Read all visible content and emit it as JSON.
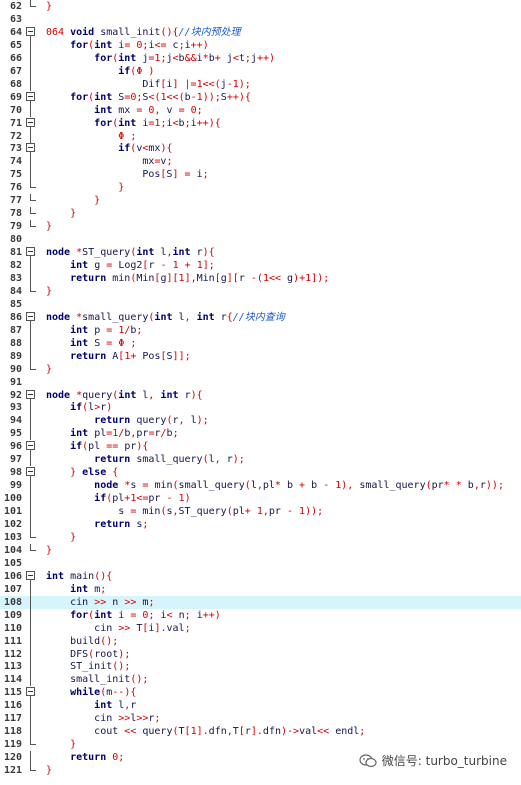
{
  "editor": {
    "highlight_line": 108,
    "lines": [
      {
        "n": "62",
        "fold": "end",
        "text": "}"
      },
      {
        "n": "63",
        "fold": "",
        "text": ""
      },
      {
        "n": "64",
        "fold": "open",
        "text": "064 void small_init(){//块内预处理"
      },
      {
        "n": "65",
        "fold": "bar",
        "text": "    for(int i= 0;i<= c;i++)"
      },
      {
        "n": "66",
        "fold": "bar",
        "text": "        for(int j=1;j<b&&i*b+ j<t;j++)"
      },
      {
        "n": "67",
        "fold": "bar",
        "text": "            if(Φ )"
      },
      {
        "n": "68",
        "fold": "bar",
        "text": "                Dif[i] |=1<<(j-1);"
      },
      {
        "n": "69",
        "fold": "open",
        "text": "    for(int S=0;S<(1<<(b-1));S++){"
      },
      {
        "n": "70",
        "fold": "bar",
        "text": "        int mx = 0, v = 0;"
      },
      {
        "n": "71",
        "fold": "open",
        "text": "        for(int i=1;i<b;i++){"
      },
      {
        "n": "72",
        "fold": "bar",
        "text": "            Φ ;"
      },
      {
        "n": "73",
        "fold": "open",
        "text": "            if(v<mx){"
      },
      {
        "n": "74",
        "fold": "bar",
        "text": "                mx=v;"
      },
      {
        "n": "75",
        "fold": "bar",
        "text": "                Pos[S] = i;"
      },
      {
        "n": "76",
        "fold": "end",
        "text": "            }"
      },
      {
        "n": "77",
        "fold": "end",
        "text": "        }"
      },
      {
        "n": "78",
        "fold": "end",
        "text": "    }"
      },
      {
        "n": "79",
        "fold": "end",
        "text": "}"
      },
      {
        "n": "80",
        "fold": "",
        "text": ""
      },
      {
        "n": "81",
        "fold": "open",
        "text": "node *ST_query(int l,int r){"
      },
      {
        "n": "82",
        "fold": "bar",
        "text": "    int g = Log2[r - 1 + 1];"
      },
      {
        "n": "83",
        "fold": "bar",
        "text": "    return min(Min[g][1],Min[g][r -(1<< g)+1]);"
      },
      {
        "n": "84",
        "fold": "end",
        "text": "}"
      },
      {
        "n": "85",
        "fold": "",
        "text": ""
      },
      {
        "n": "86",
        "fold": "open",
        "text": "node *small_query(int l, int r{//块内查询"
      },
      {
        "n": "87",
        "fold": "bar",
        "text": "    int p = 1/b;"
      },
      {
        "n": "88",
        "fold": "bar",
        "text": "    int S = Φ ;"
      },
      {
        "n": "89",
        "fold": "bar",
        "text": "    return A[1+ Pos[S]];"
      },
      {
        "n": "90",
        "fold": "end",
        "text": "}"
      },
      {
        "n": "91",
        "fold": "",
        "text": ""
      },
      {
        "n": "92",
        "fold": "open",
        "text": "node *query(int l, int r){"
      },
      {
        "n": "93",
        "fold": "bar",
        "text": "    if(l>r)"
      },
      {
        "n": "94",
        "fold": "bar",
        "text": "        return query(r, l);"
      },
      {
        "n": "95",
        "fold": "bar",
        "text": "    int pl=1/b,pr=r/b;"
      },
      {
        "n": "96",
        "fold": "open",
        "text": "    if(pl == pr){"
      },
      {
        "n": "97",
        "fold": "bar",
        "text": "        return small_query(l, r);"
      },
      {
        "n": "98",
        "fold": "open",
        "text": "    } else {"
      },
      {
        "n": "99",
        "fold": "bar",
        "text": "        node *s = min(small_query(l,pl* b + b - 1), small_query(pr* * b,r));"
      },
      {
        "n": "100",
        "fold": "bar",
        "text": "        if(pl+1<=pr - 1)"
      },
      {
        "n": "101",
        "fold": "bar",
        "text": "            s = min(s,ST_query(pl+ 1,pr - 1));"
      },
      {
        "n": "102",
        "fold": "bar",
        "text": "        return s;"
      },
      {
        "n": "103",
        "fold": "end",
        "text": "    }"
      },
      {
        "n": "104",
        "fold": "end",
        "text": "}"
      },
      {
        "n": "105",
        "fold": "",
        "text": ""
      },
      {
        "n": "106",
        "fold": "open",
        "text": "int main(){"
      },
      {
        "n": "107",
        "fold": "bar",
        "text": "    int m;"
      },
      {
        "n": "108",
        "fold": "bar",
        "text": "    cin >> n >> m;"
      },
      {
        "n": "109",
        "fold": "bar",
        "text": "    for(int i = 0; i< n; i++)"
      },
      {
        "n": "110",
        "fold": "bar",
        "text": "        cin >> T[i].val;"
      },
      {
        "n": "111",
        "fold": "bar",
        "text": "    build();"
      },
      {
        "n": "112",
        "fold": "bar",
        "text": "    DFS(root);"
      },
      {
        "n": "113",
        "fold": "bar",
        "text": "    ST_init();"
      },
      {
        "n": "114",
        "fold": "bar",
        "text": "    small_init();"
      },
      {
        "n": "115",
        "fold": "open",
        "text": "    while(m--){"
      },
      {
        "n": "116",
        "fold": "bar",
        "text": "        int l,r"
      },
      {
        "n": "117",
        "fold": "bar",
        "text": "        cin >>l>>r;"
      },
      {
        "n": "118",
        "fold": "bar",
        "text": "        cout << query(T[1].dfn,T[r].dfn)->val<< endl;"
      },
      {
        "n": "119",
        "fold": "end",
        "text": "    }"
      },
      {
        "n": "120",
        "fold": "bar",
        "text": "    return 0;"
      },
      {
        "n": "121",
        "fold": "end",
        "text": "}"
      }
    ]
  },
  "watermark": {
    "icon": "wechat-icon",
    "text": "微信号: turbo_turbine"
  },
  "colors": {
    "highlight_bg": "#d6f4fb",
    "keyword": "#00006e",
    "operator": "#d20000",
    "comment": "#1a5ad0"
  }
}
